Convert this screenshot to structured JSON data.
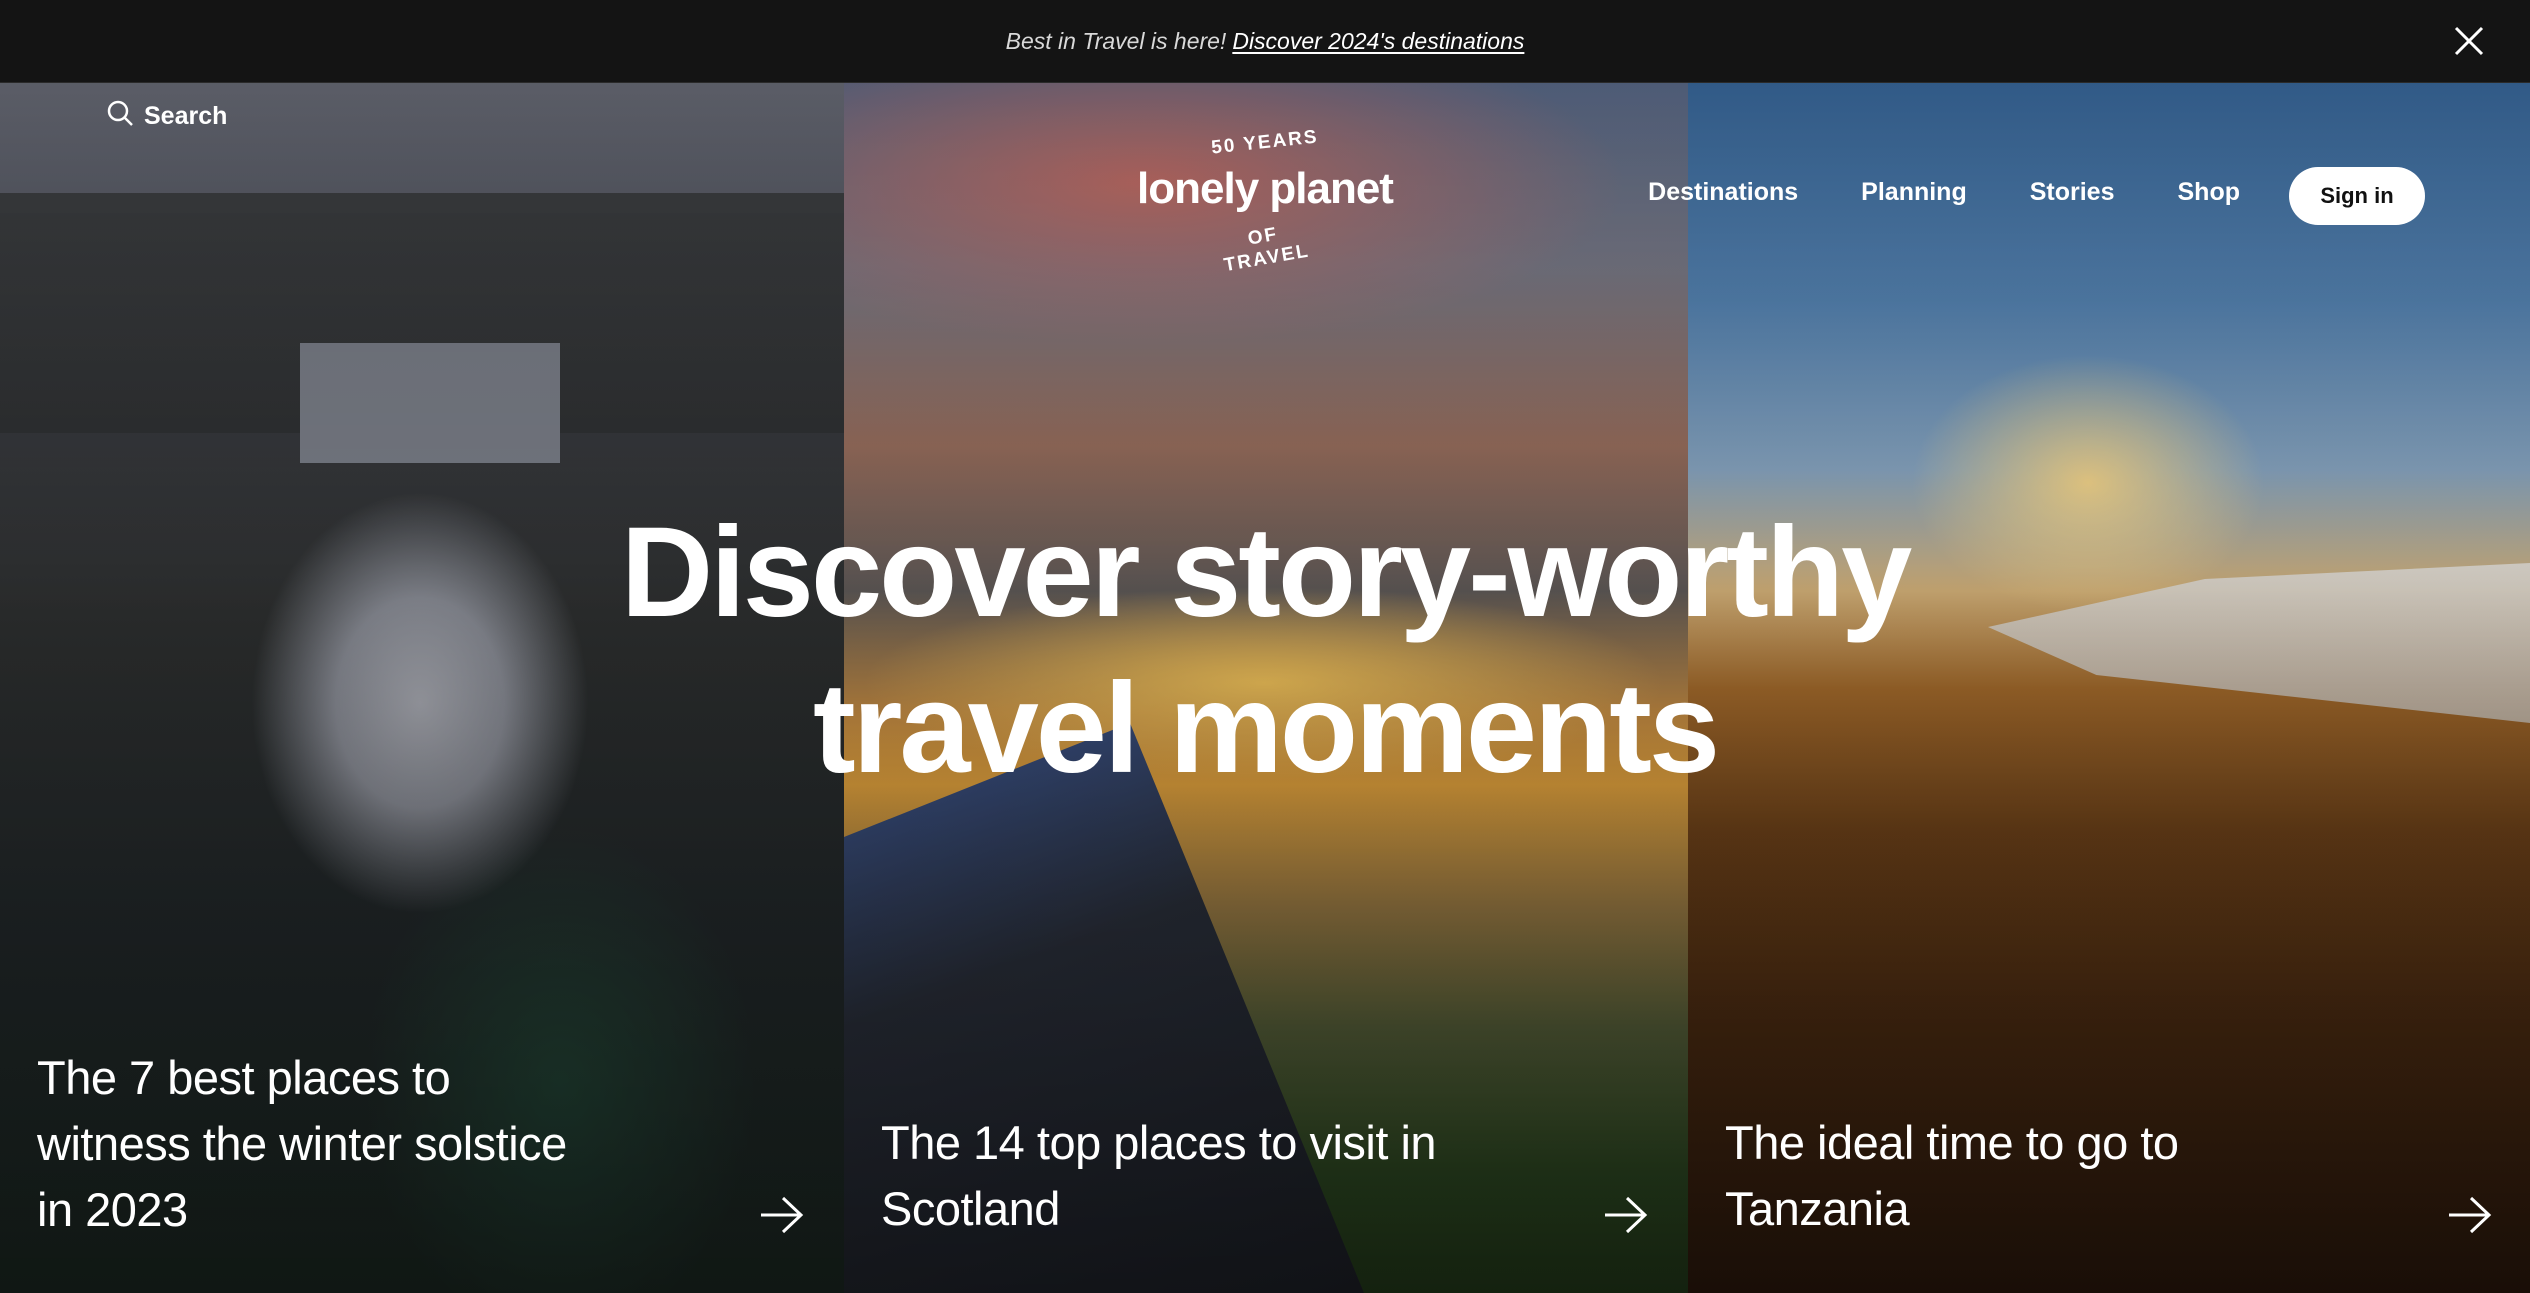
{
  "banner": {
    "lead_text": "Best in Travel is here!",
    "link_text": "Discover 2024's destinations",
    "close_icon": "close-icon"
  },
  "nav": {
    "search_label": "Search",
    "search_icon": "search-icon",
    "logo": {
      "top_arc": "50 YEARS",
      "wordmark": "lonely planet",
      "bottom_arc": "OF TRAVEL"
    },
    "links": [
      "Destinations",
      "Planning",
      "Stories",
      "Shop"
    ],
    "sign_in_label": "Sign in"
  },
  "hero": {
    "headline_line1": "Discover story-worthy",
    "headline_line2": "travel moments"
  },
  "cards": [
    {
      "title": "The 7 best places to witness the winter solstice in 2023",
      "arrow_icon": "arrow-right-icon"
    },
    {
      "title": "The 14 top places to visit in Scotland",
      "arrow_icon": "arrow-right-icon"
    },
    {
      "title": "The ideal time to go to Tanzania",
      "arrow_icon": "arrow-right-icon"
    }
  ],
  "colors": {
    "banner_bg": "#141414",
    "text": "#ffffff",
    "sign_in_bg": "#ffffff",
    "sign_in_text": "#111111"
  }
}
